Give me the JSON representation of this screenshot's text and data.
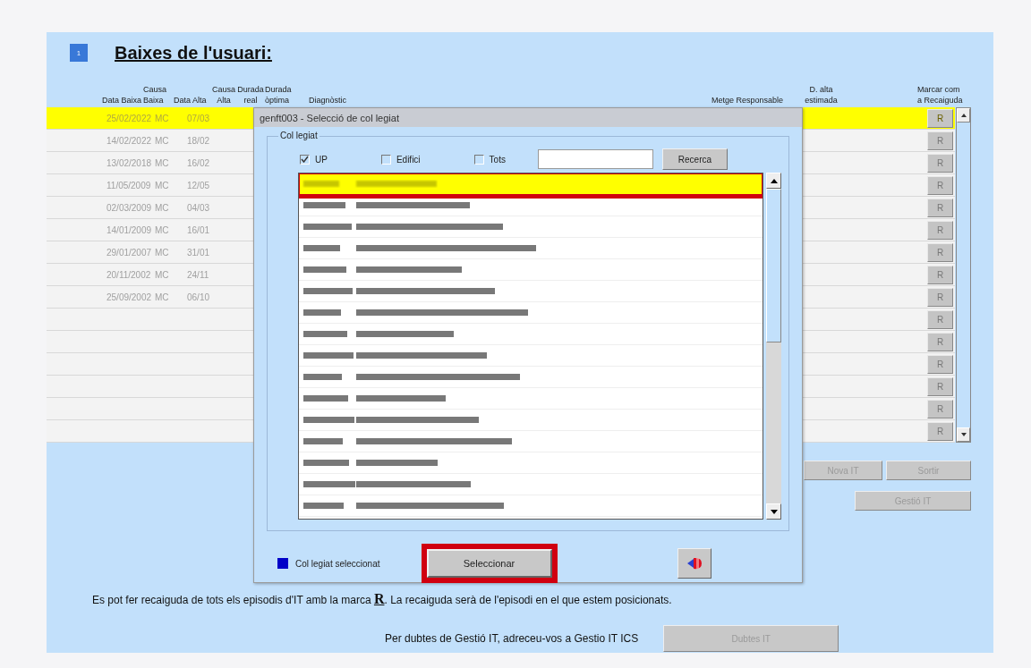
{
  "badge": "1",
  "title": "Baixes de l'usuari:",
  "table": {
    "columns": [
      {
        "lines": [
          "Data Baixa"
        ]
      },
      {
        "lines": [
          "Causa",
          "Baixa"
        ]
      },
      {
        "lines": [
          "Data Alta"
        ]
      },
      {
        "lines": [
          "Causa",
          "Alta"
        ]
      },
      {
        "lines": [
          "Durada",
          "real"
        ]
      },
      {
        "lines": [
          "Durada",
          "òptima"
        ]
      },
      {
        "lines": [
          "Diagnòstic"
        ]
      },
      {
        "lines": [
          "Metge Responsable"
        ]
      },
      {
        "lines": [
          "D. alta",
          "estimada"
        ]
      },
      {
        "lines": [
          "Marcar com",
          "a Recaiguda"
        ]
      }
    ],
    "rows": [
      {
        "data_baixa": "25/02/2022",
        "causa_baixa": "MC",
        "data_alta": "07/03",
        "mark": "R",
        "selected": true
      },
      {
        "data_baixa": "14/02/2022",
        "causa_baixa": "MC",
        "data_alta": "18/02",
        "mark": "R",
        "selected": false
      },
      {
        "data_baixa": "13/02/2018",
        "causa_baixa": "MC",
        "data_alta": "16/02",
        "mark": "R",
        "selected": false
      },
      {
        "data_baixa": "11/05/2009",
        "causa_baixa": "MC",
        "data_alta": "12/05",
        "mark": "R",
        "selected": false
      },
      {
        "data_baixa": "02/03/2009",
        "causa_baixa": "MC",
        "data_alta": "04/03",
        "mark": "R",
        "selected": false
      },
      {
        "data_baixa": "14/01/2009",
        "causa_baixa": "MC",
        "data_alta": "16/01",
        "mark": "R",
        "selected": false
      },
      {
        "data_baixa": "29/01/2007",
        "causa_baixa": "MC",
        "data_alta": "31/01",
        "mark": "R",
        "selected": false
      },
      {
        "data_baixa": "20/11/2002",
        "causa_baixa": "MC",
        "data_alta": "24/11",
        "mark": "R",
        "selected": false
      },
      {
        "data_baixa": "25/09/2002",
        "causa_baixa": "MC",
        "data_alta": "06/10",
        "mark": "R",
        "selected": false
      },
      {
        "mark": "R",
        "selected": false
      },
      {
        "mark": "R",
        "selected": false
      },
      {
        "mark": "R",
        "selected": false
      },
      {
        "mark": "R",
        "selected": false
      },
      {
        "mark": "R",
        "selected": false
      },
      {
        "mark": "R",
        "selected": false
      }
    ]
  },
  "actions": [
    {
      "label": "Nova IT",
      "disabled": true
    },
    {
      "label": "Sortir",
      "disabled": true
    }
  ],
  "gestio_button": {
    "label": "Gestió IT",
    "disabled": true
  },
  "dialog": {
    "title": "genft003 - Selecció de col legiat",
    "group": "Col legiat",
    "filters": [
      {
        "label": "UP",
        "checked": true
      },
      {
        "label": "Edifici",
        "checked": false
      },
      {
        "label": "Tots",
        "checked": false
      }
    ],
    "search_button": "Recerca",
    "list": [
      {
        "selected": true,
        "highlighted": true
      },
      {
        "selected": false,
        "highlighted": false
      },
      {
        "selected": false,
        "highlighted": false
      },
      {
        "selected": false,
        "highlighted": false
      },
      {
        "selected": false,
        "highlighted": false
      },
      {
        "selected": false,
        "highlighted": false
      },
      {
        "selected": false,
        "highlighted": false
      },
      {
        "selected": false,
        "highlighted": false
      },
      {
        "selected": false,
        "highlighted": false
      },
      {
        "selected": false,
        "highlighted": false
      },
      {
        "selected": false,
        "highlighted": false
      },
      {
        "selected": false,
        "highlighted": false
      },
      {
        "selected": false,
        "highlighted": false
      },
      {
        "selected": false,
        "highlighted": false
      },
      {
        "selected": false,
        "highlighted": false
      },
      {
        "selected": false,
        "highlighted": false
      }
    ],
    "legend": "Col legiat seleccionat",
    "select_button": {
      "label": "Seleccionar",
      "highlighted": true
    }
  },
  "note": "Es pot fer recaiguda de tots els episodis d'IT amb la marca **R**. La recaiguda serà de l'episodi en el que estem posicionats.",
  "help": {
    "text": "Per dubtes de Gestió IT, adreceu-vos a Gestio IT ICS",
    "button": {
      "label": "Dubtes IT",
      "disabled": true
    }
  }
}
